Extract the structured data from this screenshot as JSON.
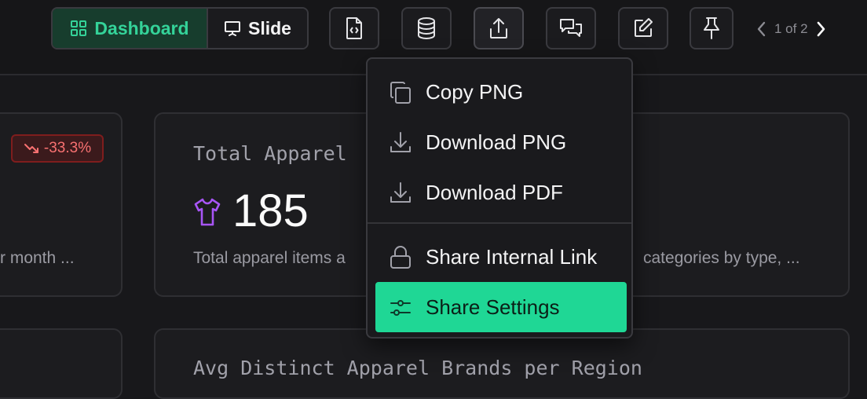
{
  "toolbar": {
    "view_toggle": {
      "dashboard_label": "Dashboard",
      "slide_label": "Slide",
      "active": "Dashboard"
    },
    "pager": {
      "text": "1 of 2"
    }
  },
  "cards": {
    "left": {
      "badge": "-33.3%",
      "desc": "r month ..."
    },
    "total_apparel": {
      "title": "Total Apparel",
      "value": "185",
      "desc_left": "Total apparel items a",
      "desc_right": "categories by type, ..."
    },
    "avg_brands": {
      "title": "Avg Distinct Apparel Brands per Region"
    }
  },
  "share_menu": {
    "items": [
      {
        "label": "Copy PNG",
        "icon": "copy-icon"
      },
      {
        "label": "Download PNG",
        "icon": "download-icon"
      },
      {
        "label": "Download PDF",
        "icon": "download-icon"
      },
      {
        "label": "Share Internal Link",
        "icon": "lock-icon"
      },
      {
        "label": "Share Settings",
        "icon": "sliders-icon",
        "highlighted": true
      }
    ]
  },
  "colors": {
    "accent_green": "#34d399",
    "menu_highlight": "#1fd795",
    "negative_red": "#f87171",
    "apparel_icon": "#a855f7"
  }
}
